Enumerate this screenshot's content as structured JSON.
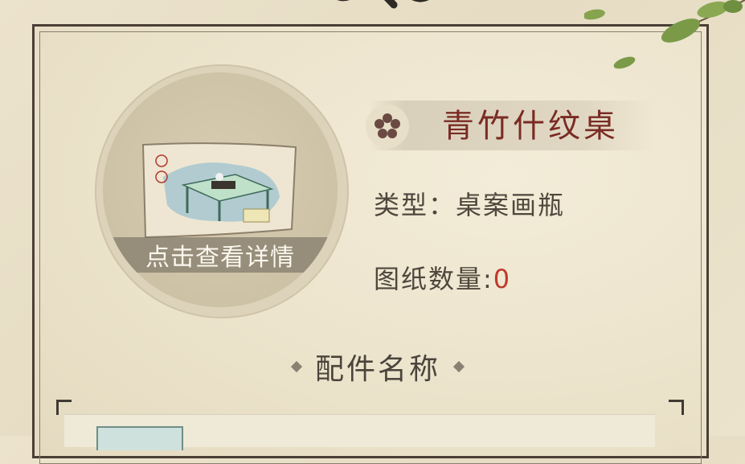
{
  "item": {
    "name": "青竹什纹桌",
    "type_label": "类型：",
    "type_value": "桌案画瓶",
    "blueprint_label": "图纸数量:",
    "blueprint_count": "0"
  },
  "preview": {
    "details_label": "点击查看详情"
  },
  "parts_section": {
    "title": "配件名称"
  },
  "colors": {
    "name": "#7a2b24",
    "count_value": "#c0392b",
    "frame": "#4a3f35"
  },
  "icons": {
    "badge": "flower-icon",
    "top_right_decor": "leaf-branch-icon"
  }
}
